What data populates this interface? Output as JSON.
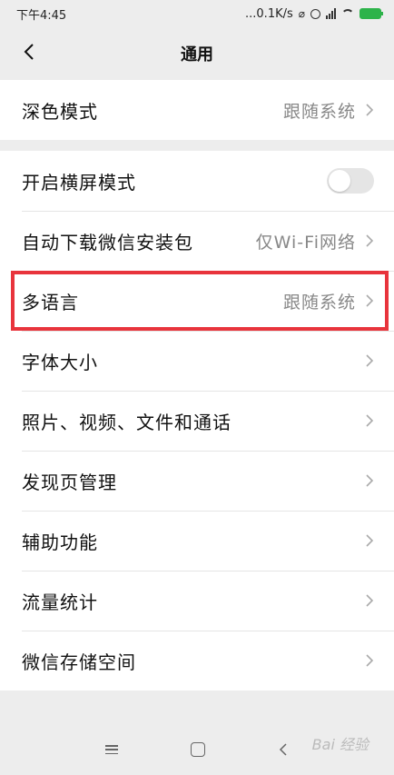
{
  "status": {
    "time": "下午4:45",
    "net": "...0.1K/s"
  },
  "nav": {
    "title": "通用"
  },
  "rows": [
    {
      "label": "深色模式",
      "value": "跟随系统"
    },
    {
      "label": "开启横屏模式"
    },
    {
      "label": "自动下载微信安装包",
      "value": "仅Wi-Fi网络"
    },
    {
      "label": "多语言",
      "value": "跟随系统"
    },
    {
      "label": "字体大小"
    },
    {
      "label": "照片、视频、文件和通话"
    },
    {
      "label": "发现页管理"
    },
    {
      "label": "辅助功能"
    },
    {
      "label": "流量统计"
    },
    {
      "label": "微信存储空间"
    }
  ],
  "toggle_landscape": {
    "on": false
  },
  "watermark": "Bai 经验",
  "colors": {
    "highlight": "#e8343c",
    "battery": "#2db34a"
  }
}
